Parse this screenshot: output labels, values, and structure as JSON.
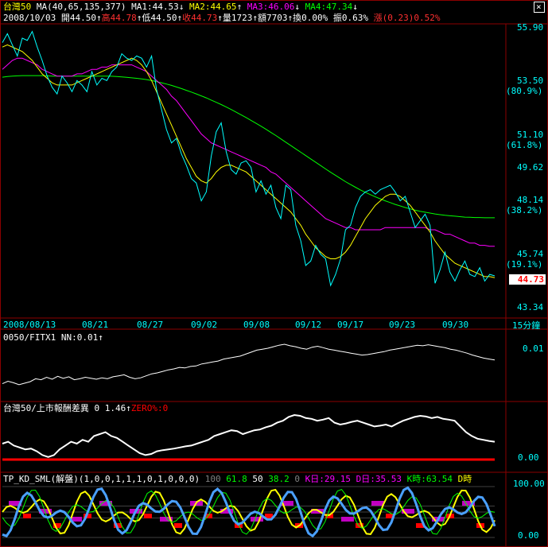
{
  "header": {
    "line1": [
      {
        "text": "台灣50",
        "color": "#ffff00"
      },
      {
        "text": " MA(40,65,135,377)",
        "color": "#ffffff"
      },
      {
        "text": " MA1:44.53",
        "color": "#ffffff"
      },
      {
        "text": "↓",
        "color": "#ffffff"
      },
      {
        "text": " MA2:44.65",
        "color": "#ffff00"
      },
      {
        "text": "↑",
        "color": "#ffffff"
      },
      {
        "text": " MA3:46.06",
        "color": "#ff00ff"
      },
      {
        "text": "↓",
        "color": "#ffffff"
      },
      {
        "text": " MA4:47.34",
        "color": "#00ff00"
      },
      {
        "text": "↓",
        "color": "#ffffff"
      }
    ],
    "line2": [
      {
        "text": "2008/10/03 ",
        "color": "#ffffff"
      },
      {
        "text": "開44.50",
        "color": "#ffffff"
      },
      {
        "text": "↑",
        "color": "#ffffff"
      },
      {
        "text": "高44.78",
        "color": "#ff3030"
      },
      {
        "text": "↑",
        "color": "#ffffff"
      },
      {
        "text": "低44.50",
        "color": "#ffffff"
      },
      {
        "text": "↑",
        "color": "#ffffff"
      },
      {
        "text": "收44.73",
        "color": "#ff3030"
      },
      {
        "text": "↑",
        "color": "#ffffff"
      },
      {
        "text": "量1723",
        "color": "#ffffff"
      },
      {
        "text": "↑",
        "color": "#ffffff"
      },
      {
        "text": "額7703",
        "color": "#ffffff"
      },
      {
        "text": "↑",
        "color": "#ffffff"
      },
      {
        "text": "換0.00%",
        "color": "#ffffff"
      },
      {
        "text": " 振0.63%",
        "color": "#ffffff"
      },
      {
        "text": " 漲(0.23)0.52%",
        "color": "#ff3030"
      }
    ],
    "close_label": "×"
  },
  "colors": {
    "background": "#000000",
    "grid": "#8b0000",
    "price_line": "#00ffff",
    "ma1": "#ffffff",
    "ma2": "#ffff00",
    "ma3": "#ff00ff",
    "ma4": "#00ff00",
    "panel2_line": "#ffffff",
    "panel3_line": "#ffffff",
    "zero_line": "#ff0000",
    "axis_text": "#00ffff",
    "current_price_bg": "#ffffff",
    "current_price_text": "#ff0000"
  },
  "panel1": {
    "y_labels": [
      {
        "text": "55.90",
        "value": 55.9
      },
      {
        "text": "53.50",
        "value": 53.5
      },
      {
        "text": "(80.9%)",
        "value": 53.5,
        "pct": true
      },
      {
        "text": "51.10",
        "value": 51.1
      },
      {
        "text": "(61.8%)",
        "value": 51.1,
        "pct": true
      },
      {
        "text": "49.62",
        "value": 49.62
      },
      {
        "text": "48.14",
        "value": 48.14
      },
      {
        "text": "(38.2%)",
        "value": 48.14,
        "pct": true
      },
      {
        "text": "45.74",
        "value": 45.74
      },
      {
        "text": "(19.1%)",
        "value": 45.74,
        "pct": true
      },
      {
        "text": "43.34",
        "value": 43.34
      }
    ],
    "current_price": "44.73",
    "x_labels": [
      "2008/08/13",
      "08/21",
      "08/27",
      "09/02",
      "09/08",
      "09/12",
      "09/17",
      "09/23",
      "09/30"
    ],
    "period_label": "15分鐘",
    "ylim": [
      43.34,
      55.9
    ]
  },
  "panel2": {
    "title_parts": [
      {
        "text": "0050/FITX1 ",
        "color": "#ffffff"
      },
      {
        "text": "NN:0.01",
        "color": "#ffffff"
      },
      {
        "text": "↑",
        "color": "#ffffff"
      }
    ],
    "y_label": "0.01"
  },
  "panel3": {
    "title_parts": [
      {
        "text": "台灣50/上市報酬差異 ",
        "color": "#ffffff"
      },
      {
        "text": "0 ",
        "color": "#ffffff"
      },
      {
        "text": "1.46",
        "color": "#ffffff"
      },
      {
        "text": "↑",
        "color": "#ffffff"
      },
      {
        "text": "ZERO%:0",
        "color": "#ff0000"
      }
    ],
    "y_label": "0.00"
  },
  "panel4": {
    "title_parts": [
      {
        "text": "TP_KD_SML(解盤)(1,0,0,1,1,1,0,1,0,0,0)",
        "color": "#ffffff"
      },
      {
        "text": " 100",
        "color": "#808080"
      },
      {
        "text": " 61.8",
        "color": "#00ff00"
      },
      {
        "text": " 50",
        "color": "#ffffff"
      },
      {
        "text": " 38.2",
        "color": "#00ff00"
      },
      {
        "text": " 0",
        "color": "#808080"
      },
      {
        "text": " K日:29.15",
        "color": "#ff00ff"
      },
      {
        "text": " D日:35.53",
        "color": "#ff00ff"
      },
      {
        "text": " K時:63.54",
        "color": "#00ff00"
      },
      {
        "text": " D時",
        "color": "#ffff00"
      }
    ],
    "y_labels": [
      "100.00",
      "0.00"
    ]
  },
  "chart_data": [
    {
      "type": "line",
      "title": "台灣50",
      "x_ticks": [
        "2008/08/13",
        "08/21",
        "08/27",
        "09/02",
        "09/08",
        "09/12",
        "09/17",
        "09/23",
        "09/30"
      ],
      "ylim": [
        43.34,
        55.9
      ],
      "series": [
        {
          "name": "台灣50",
          "values": [
            55.2,
            55.6,
            55.1,
            54.6,
            55.4,
            55.3,
            55.7,
            55.0,
            54.4,
            53.7,
            53.2,
            52.9,
            53.7,
            53.4,
            53.0,
            53.5,
            53.3,
            53.0,
            53.9,
            53.3,
            53.6,
            53.5,
            53.9,
            54.1,
            54.7,
            54.5,
            54.4,
            54.6,
            54.5,
            54.1,
            54.6,
            53.1,
            52.2,
            51.3,
            50.7,
            50.9,
            50.2,
            49.7,
            49.1,
            48.9,
            48.1,
            48.5,
            50.1,
            51.2,
            51.6,
            50.3,
            49.5,
            49.3,
            49.8,
            49.9,
            49.6,
            48.5,
            49.0,
            48.4,
            48.8,
            47.8,
            47.3,
            48.8,
            48.6,
            47.0,
            46.3,
            45.2,
            45.4,
            46.1,
            45.7,
            45.5,
            44.3,
            44.8,
            45.5,
            46.8,
            47.0,
            47.8,
            48.3,
            48.5,
            48.6,
            48.4,
            48.6,
            48.7,
            48.8,
            48.5,
            48.1,
            48.3,
            47.6,
            46.9,
            47.2,
            47.5,
            47.0,
            44.4,
            45.0,
            45.8,
            44.9,
            44.5,
            45.0,
            45.4,
            44.8,
            44.7,
            45.1,
            44.5,
            44.8,
            44.73
          ]
        },
        {
          "name": "MA1",
          "values": []
        },
        {
          "name": "MA2",
          "values": [
            55.0,
            55.1,
            55.0,
            54.9,
            54.8,
            54.6,
            54.4,
            54.1,
            53.8,
            53.6,
            53.4,
            53.3,
            53.3,
            53.3,
            53.3,
            53.4,
            53.5,
            53.6,
            53.7,
            53.8,
            53.9,
            54.0,
            54.1,
            54.2,
            54.3,
            54.4,
            54.5,
            54.4,
            54.2,
            53.9,
            53.5,
            53.0,
            52.5,
            52.0,
            51.5,
            51.0,
            50.5,
            50.0,
            49.6,
            49.2,
            49.0,
            48.9,
            49.1,
            49.4,
            49.6,
            49.7,
            49.7,
            49.6,
            49.5,
            49.4,
            49.2,
            49.0,
            48.8,
            48.6,
            48.4,
            48.2,
            48.0,
            47.8,
            47.6,
            47.3,
            47.0,
            46.6,
            46.3,
            46.0,
            45.8,
            45.6,
            45.5,
            45.5,
            45.6,
            45.8,
            46.1,
            46.5,
            46.9,
            47.3,
            47.6,
            47.9,
            48.1,
            48.3,
            48.4,
            48.4,
            48.3,
            48.1,
            47.9,
            47.6,
            47.3,
            47.0,
            46.7,
            46.3,
            46.0,
            45.7,
            45.5,
            45.3,
            45.2,
            45.1,
            45.0,
            44.9,
            44.8,
            44.7,
            44.7,
            44.65
          ]
        },
        {
          "name": "MA3",
          "values": [
            54.0,
            54.2,
            54.4,
            54.5,
            54.5,
            54.4,
            54.3,
            54.2,
            54.0,
            53.9,
            53.8,
            53.7,
            53.7,
            53.7,
            53.7,
            53.8,
            53.8,
            53.9,
            54.0,
            54.0,
            54.1,
            54.1,
            54.2,
            54.2,
            54.2,
            54.2,
            54.2,
            54.1,
            54.0,
            53.9,
            53.7,
            53.5,
            53.3,
            53.1,
            52.8,
            52.6,
            52.3,
            52.0,
            51.7,
            51.4,
            51.1,
            50.9,
            50.7,
            50.6,
            50.5,
            50.4,
            50.3,
            50.2,
            50.1,
            50.0,
            49.9,
            49.8,
            49.7,
            49.6,
            49.4,
            49.3,
            49.1,
            48.9,
            48.7,
            48.5,
            48.3,
            48.1,
            47.9,
            47.7,
            47.5,
            47.3,
            47.2,
            47.1,
            47.0,
            46.9,
            46.9,
            46.8,
            46.8,
            46.8,
            46.8,
            46.8,
            46.8,
            46.9,
            46.9,
            46.9,
            46.9,
            46.9,
            46.9,
            46.9,
            46.9,
            46.9,
            46.8,
            46.8,
            46.7,
            46.6,
            46.6,
            46.5,
            46.4,
            46.3,
            46.2,
            46.2,
            46.1,
            46.1,
            46.06,
            46.06
          ]
        },
        {
          "name": "MA4",
          "values": [
            53.65,
            53.68,
            53.7,
            53.71,
            53.72,
            53.72,
            53.72,
            53.72,
            53.72,
            53.71,
            53.7,
            53.7,
            53.7,
            53.7,
            53.7,
            53.7,
            53.7,
            53.7,
            53.7,
            53.7,
            53.7,
            53.7,
            53.69,
            53.68,
            53.66,
            53.64,
            53.62,
            53.6,
            53.57,
            53.54,
            53.5,
            53.45,
            53.4,
            53.34,
            53.28,
            53.21,
            53.14,
            53.06,
            52.98,
            52.9,
            52.81,
            52.72,
            52.62,
            52.52,
            52.42,
            52.31,
            52.2,
            52.08,
            51.96,
            51.84,
            51.71,
            51.58,
            51.45,
            51.31,
            51.17,
            51.03,
            50.88,
            50.73,
            50.58,
            50.43,
            50.28,
            50.13,
            49.98,
            49.83,
            49.68,
            49.53,
            49.38,
            49.24,
            49.1,
            48.96,
            48.83,
            48.71,
            48.59,
            48.48,
            48.38,
            48.28,
            48.19,
            48.1,
            48.02,
            47.94,
            47.87,
            47.8,
            47.74,
            47.68,
            47.63,
            47.59,
            47.55,
            47.51,
            47.48,
            47.45,
            47.43,
            47.41,
            47.39,
            47.37,
            47.36,
            47.35,
            47.35,
            47.34,
            47.34,
            47.34
          ]
        }
      ]
    },
    {
      "type": "line",
      "title": "0050/FITX1",
      "series": [
        {
          "name": "NN",
          "values": [
            0.2,
            0.25,
            0.22,
            0.18,
            0.21,
            0.24,
            0.3,
            0.28,
            0.33,
            0.29,
            0.35,
            0.31,
            0.34,
            0.28,
            0.3,
            0.33,
            0.31,
            0.29,
            0.32,
            0.3,
            0.34,
            0.36,
            0.38,
            0.33,
            0.3,
            0.32,
            0.36,
            0.4,
            0.42,
            0.45,
            0.48,
            0.5,
            0.53,
            0.52,
            0.55,
            0.56,
            0.6,
            0.62,
            0.64,
            0.66,
            0.7,
            0.72,
            0.74,
            0.76,
            0.8,
            0.84,
            0.88,
            0.9,
            0.92,
            0.95,
            0.98,
            1.0,
            0.97,
            0.95,
            0.92,
            0.9,
            0.94,
            0.96,
            0.93,
            0.9,
            0.88,
            0.86,
            0.84,
            0.82,
            0.8,
            0.78,
            0.79,
            0.81,
            0.83,
            0.85,
            0.88,
            0.9,
            0.92,
            0.94,
            0.96,
            0.98,
            0.97,
            0.99,
            0.97,
            0.95,
            0.93,
            0.9,
            0.88,
            0.85,
            0.82,
            0.78,
            0.75,
            0.72,
            0.7,
            0.68
          ]
        }
      ]
    },
    {
      "type": "line",
      "title": "台灣50/上市報酬差異",
      "series": [
        {
          "name": "報酬差異",
          "values": [
            0.25,
            0.3,
            0.2,
            0.15,
            0.1,
            0.12,
            0.05,
            -0.05,
            -0.1,
            -0.05,
            0.1,
            0.2,
            0.3,
            0.25,
            0.35,
            0.3,
            0.45,
            0.5,
            0.55,
            0.45,
            0.4,
            0.3,
            0.2,
            0.1,
            0.0,
            -0.05,
            -0.02,
            0.05,
            0.08,
            0.1,
            0.12,
            0.15,
            0.18,
            0.2,
            0.25,
            0.3,
            0.35,
            0.45,
            0.5,
            0.55,
            0.6,
            0.58,
            0.5,
            0.55,
            0.6,
            0.62,
            0.68,
            0.72,
            0.8,
            0.85,
            0.95,
            1.0,
            0.98,
            0.92,
            0.9,
            0.85,
            0.88,
            0.92,
            0.8,
            0.75,
            0.78,
            0.82,
            0.85,
            0.8,
            0.75,
            0.7,
            0.72,
            0.75,
            0.7,
            0.78,
            0.85,
            0.9,
            0.95,
            0.98,
            0.96,
            0.92,
            0.95,
            0.9,
            0.88,
            0.85,
            0.7,
            0.55,
            0.45,
            0.38,
            0.35,
            0.32,
            0.3
          ]
        }
      ]
    }
  ]
}
